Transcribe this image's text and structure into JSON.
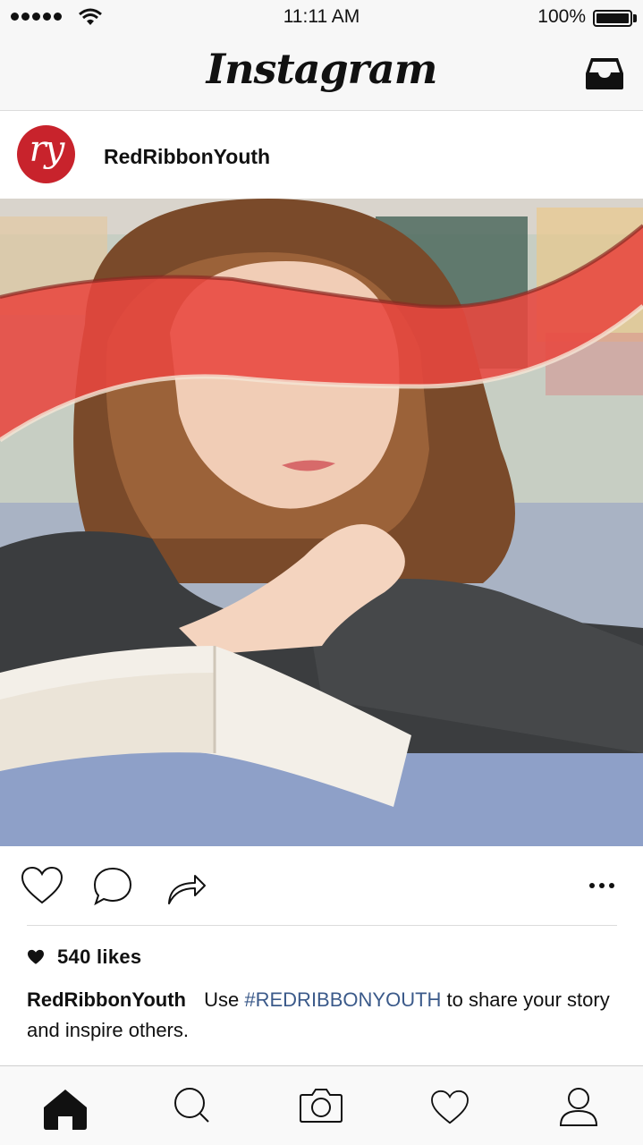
{
  "status_bar": {
    "time": "11:11 AM",
    "battery_percent": "100%",
    "signal_bars": 5,
    "icons": [
      "signal-dots-icon",
      "wifi-icon",
      "battery-icon"
    ]
  },
  "header": {
    "logo": "Instagram",
    "inbox_icon": "inbox-tray-icon"
  },
  "post": {
    "username": "RedRibbonYouth",
    "avatar_text": "ry",
    "avatar_color": "#c8232c",
    "image": "student-with-red-ribbon-photo",
    "likes": "540 likes",
    "caption": {
      "username": "RedRibbonYouth",
      "text_before": "Use",
      "hashtag": "#REDRIBBONYOUTH",
      "text_after": "to share your story and inspire others."
    },
    "actions": [
      "heart-icon",
      "comment-icon",
      "share-icon",
      "more-icon"
    ]
  },
  "tab_bar": {
    "items": [
      "home-icon",
      "search-icon",
      "camera-icon",
      "activity-heart-icon",
      "profile-icon"
    ],
    "active": "home-icon"
  },
  "colors": {
    "ribbon": "#e8473f",
    "hashtag": "#3b5a8a",
    "bar_background": "#f7f7f7"
  }
}
